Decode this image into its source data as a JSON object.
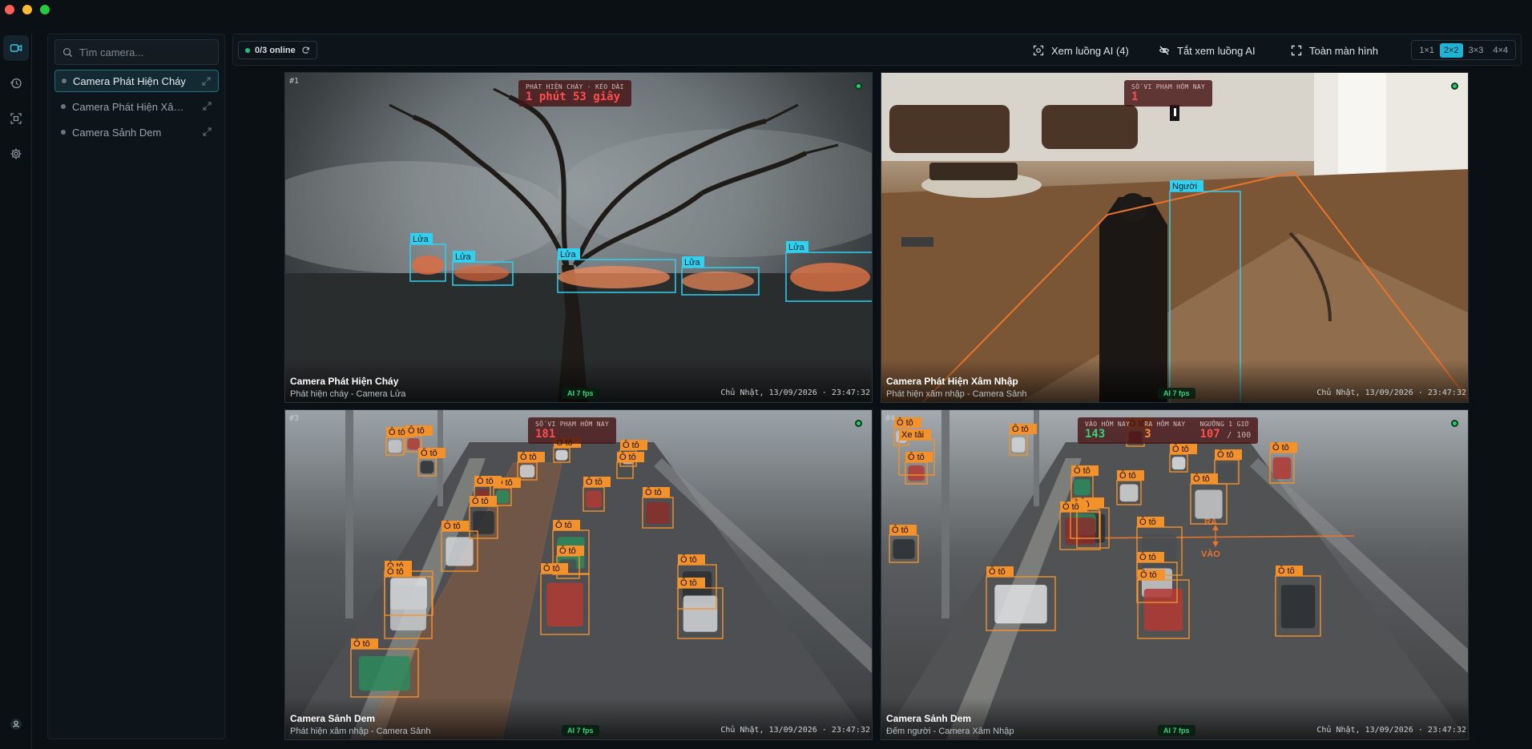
{
  "window": {
    "controls": [
      "close",
      "minimize",
      "zoom"
    ]
  },
  "rail": {
    "items": [
      {
        "icon": "video-camera-icon",
        "active": true
      },
      {
        "icon": "history-icon",
        "active": false
      },
      {
        "icon": "scan-icon",
        "active": false
      },
      {
        "icon": "gear-icon",
        "active": false
      }
    ],
    "bottom_icon": "user-icon"
  },
  "sidebar": {
    "search_placeholder": "Tìm camera...",
    "cameras": [
      {
        "label": "Camera Phát Hiện Cháy",
        "active": true
      },
      {
        "label": "Camera Phát Hiện Xâm Nhập",
        "active": false
      },
      {
        "label": "Camera Sảnh Dem",
        "active": false
      }
    ]
  },
  "toolbar": {
    "online_status": "0/3 online",
    "view_ai_label": "Xem luồng AI (4)",
    "hide_ai_label": "Tắt xem luồng AI",
    "fullscreen_label": "Toàn màn hình",
    "grid_options": [
      "1×1",
      "2×2",
      "3×3",
      "4×4"
    ],
    "grid_selected": "2×2"
  },
  "accent_colors": {
    "primary": "#1fb3d6",
    "online": "#22c07a",
    "detect_cyan": "#2fd0f0",
    "detect_orange": "#f3922b",
    "zone": "#e8752b"
  },
  "cells": [
    {
      "num": "#1",
      "title": "Camera Phát Hiện Cháy",
      "subtitle": "Phát hiện cháy - Camera Lửa",
      "fps": "AI 7 fps",
      "timestamp": "Chủ Nhật, 13/09/2026 · 23:47:32",
      "stats": [
        {
          "label": "PHÁT HIỆN CHÁY · KÉO DÀI",
          "value": "1 phút 53 giây"
        }
      ],
      "detections": {
        "label": "Lửa",
        "count": 5
      }
    },
    {
      "num": "#2",
      "title": "Camera Phát Hiện Xâm Nhập",
      "subtitle": "Phát hiện xâm nhập - Camera Sảnh",
      "fps": "AI 7 fps",
      "timestamp": "Chủ Nhật, 13/09/2026 · 23:47:32",
      "stats": [
        {
          "label": "SỐ VI PHẠM HÔM NAY",
          "value": "1"
        }
      ],
      "detections": {
        "label": "Người",
        "count": 1
      }
    },
    {
      "num": "#3",
      "title": "Camera Sảnh Dem",
      "subtitle": "Phát hiện xâm nhập - Camera Sảnh",
      "fps": "AI 7 fps",
      "timestamp": "Chủ Nhật, 13/09/2026 · 23:47:32",
      "stats": [
        {
          "label": "SỐ VI PHẠM HÔM NAY",
          "value": "181"
        }
      ],
      "detections": {
        "label": "Ô tô",
        "count": 24
      }
    },
    {
      "num": "#4",
      "title": "Camera Sảnh Dem",
      "subtitle": "Đếm người - Camera Xâm Nhập",
      "fps": "AI 7 fps",
      "timestamp": "Chủ Nhật, 13/09/2026 · 23:47:32",
      "stats": [
        {
          "label": "VÀO HÔM NAY",
          "value": "143"
        },
        {
          "label": "RA HÔM NAY",
          "value": "3"
        },
        {
          "label": "NGƯỠNG 1 GIỜ",
          "value": "107",
          "max": "/ 100"
        }
      ],
      "detections": {
        "label": "Ô tô",
        "extra_label": "Xe tải",
        "count": 21
      },
      "line_labels": {
        "out": "RA",
        "in": "VÀO"
      }
    }
  ]
}
